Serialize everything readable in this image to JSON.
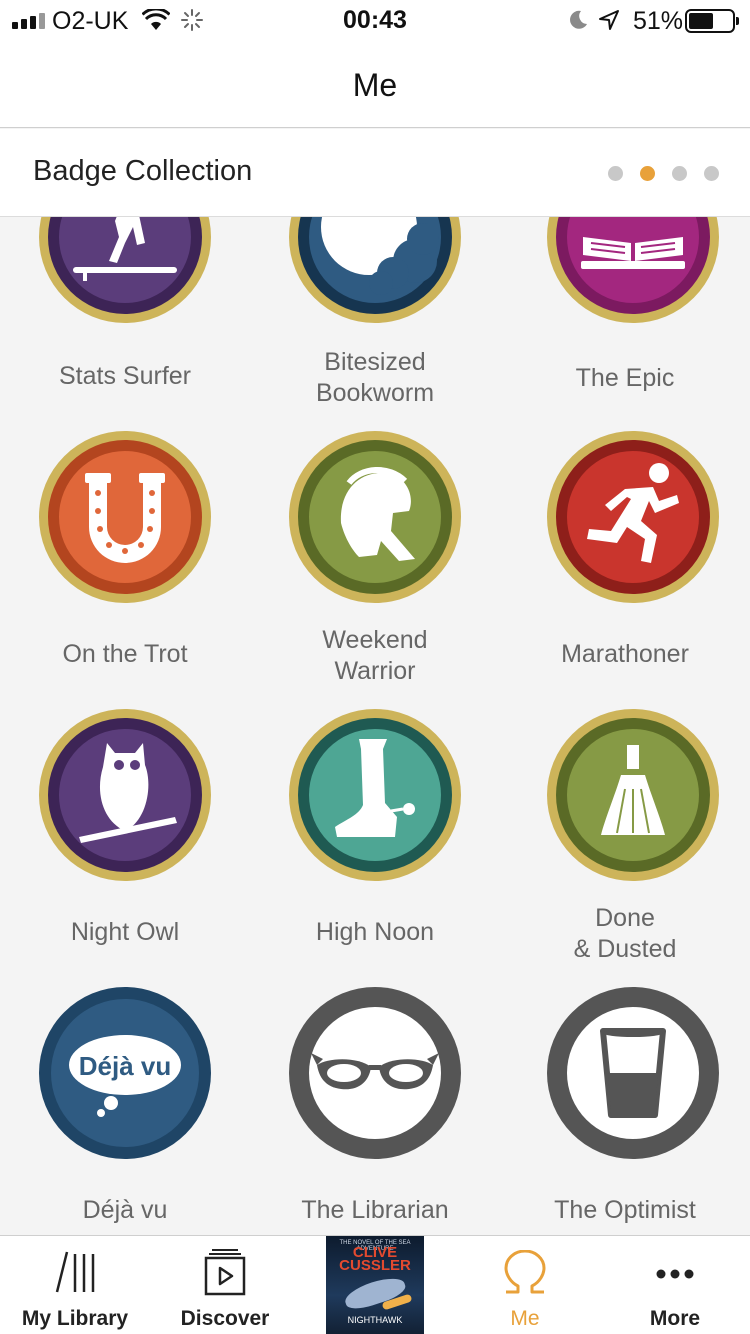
{
  "status_bar": {
    "carrier": "O2-UK",
    "time": "00:43",
    "battery": "51%"
  },
  "nav": {
    "title": "Me"
  },
  "section": {
    "title": "Badge Collection",
    "page_count": 4,
    "active_page": 2
  },
  "colors": {
    "accent": "#e8a13a",
    "gold_ring": "#cdb45a",
    "purple": "#5b3d7b",
    "navy": "#1f4566",
    "magenta": "#a3277f",
    "orange": "#e0673a",
    "olive": "#869a45",
    "red": "#c9352d",
    "teal": "#4ea694",
    "gray": "#555555"
  },
  "badges": [
    {
      "label": "Stats Surfer",
      "icon": "surfer-icon",
      "theme": "purple"
    },
    {
      "label": "Bitesized\nBookworm",
      "icon": "bitten-moon-icon",
      "theme": "navy"
    },
    {
      "label": "The Epic",
      "icon": "open-book-icon",
      "theme": "magenta"
    },
    {
      "label": "On the Trot",
      "icon": "horseshoe-icon",
      "theme": "orange"
    },
    {
      "label": "Weekend\nWarrior",
      "icon": "spartan-helmet-icon",
      "theme": "olive"
    },
    {
      "label": "Marathoner",
      "icon": "runner-icon",
      "theme": "red"
    },
    {
      "label": "Night Owl",
      "icon": "owl-icon",
      "theme": "purple"
    },
    {
      "label": "High Noon",
      "icon": "cowboy-boot-icon",
      "theme": "teal"
    },
    {
      "label": "Done\n& Dusted",
      "icon": "broom-icon",
      "theme": "olive"
    },
    {
      "label": "Déjà vu",
      "icon": "speech-bubble-icon",
      "theme": "navy",
      "bubble_text": "Déjà vu"
    },
    {
      "label": "The Librarian",
      "icon": "cat-eye-glasses-icon",
      "theme": "gray"
    },
    {
      "label": "The Optimist",
      "icon": "half-full-glass-icon",
      "theme": "gray"
    }
  ],
  "tabs": [
    {
      "label": "My Library",
      "icon": "library-icon"
    },
    {
      "label": "Discover",
      "icon": "discover-play-icon"
    },
    {
      "label": "Me",
      "icon": "omega-icon",
      "active": true
    },
    {
      "label": "More",
      "icon": "more-dots-icon"
    }
  ],
  "now_playing": {
    "series_line": "THE NOVEL OF THE SEA ADVENTURE",
    "author_line1": "CLIVE",
    "author_line2": "CUSSLER",
    "title": "NIGHTHAWK"
  }
}
